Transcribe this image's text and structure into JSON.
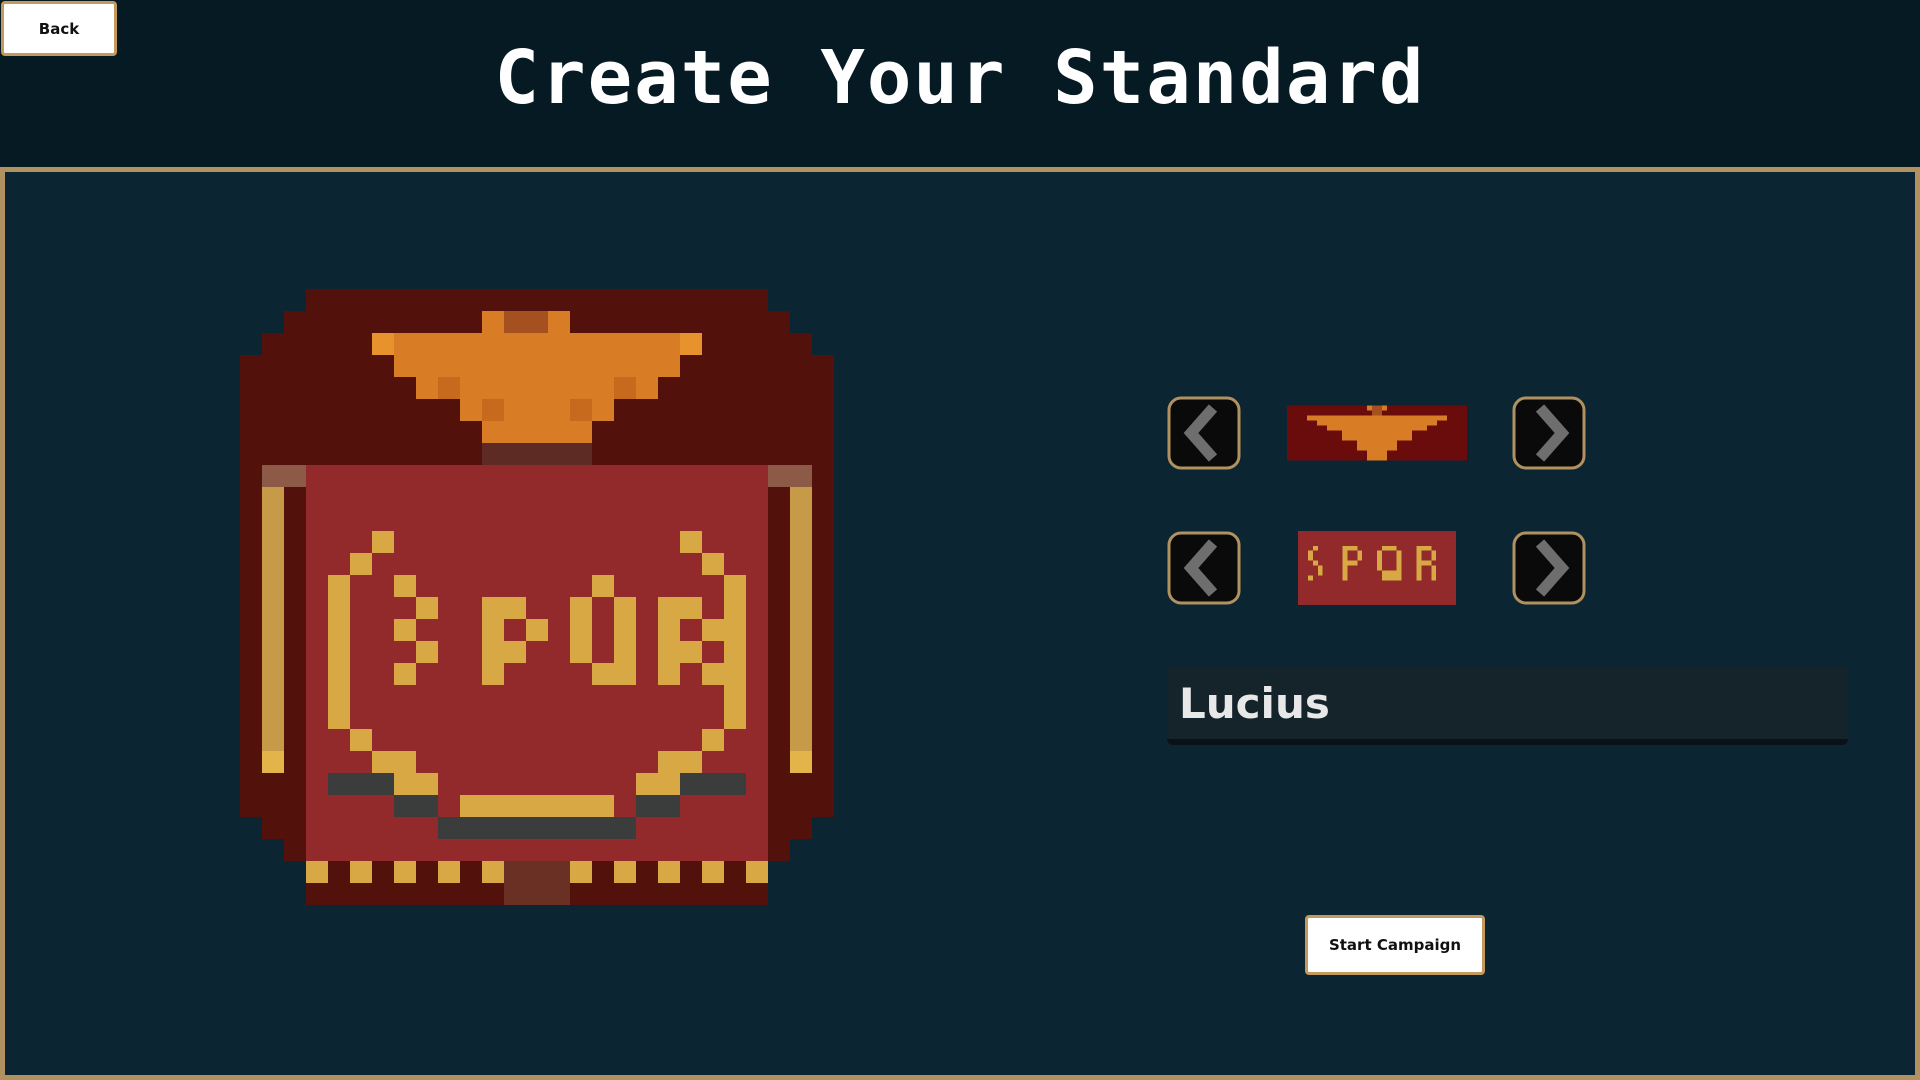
{
  "header": {
    "title": "Create Your Standard",
    "back_label": "Back"
  },
  "standard": {
    "crest_icon": "eagle-crest-icon",
    "emblem_text": "SPQR",
    "colors": {
      "frame": "#52110b",
      "banner": "#922a2b",
      "gold": "#d8a844",
      "eagle": "#d87c26"
    }
  },
  "selectors": {
    "crest": {
      "prev_icon": "chevron-left-icon",
      "next_icon": "chevron-right-icon",
      "preview_icon": "eagle-crest-icon"
    },
    "emblem": {
      "prev_icon": "chevron-left-icon",
      "next_icon": "chevron-right-icon",
      "preview_text": "SPQR"
    }
  },
  "name_field": {
    "value": "Lucius"
  },
  "start_label": "Start Campaign",
  "theme": {
    "background": "#0c2532",
    "header_background": "#061a24",
    "border_gold": "#b0915f"
  }
}
